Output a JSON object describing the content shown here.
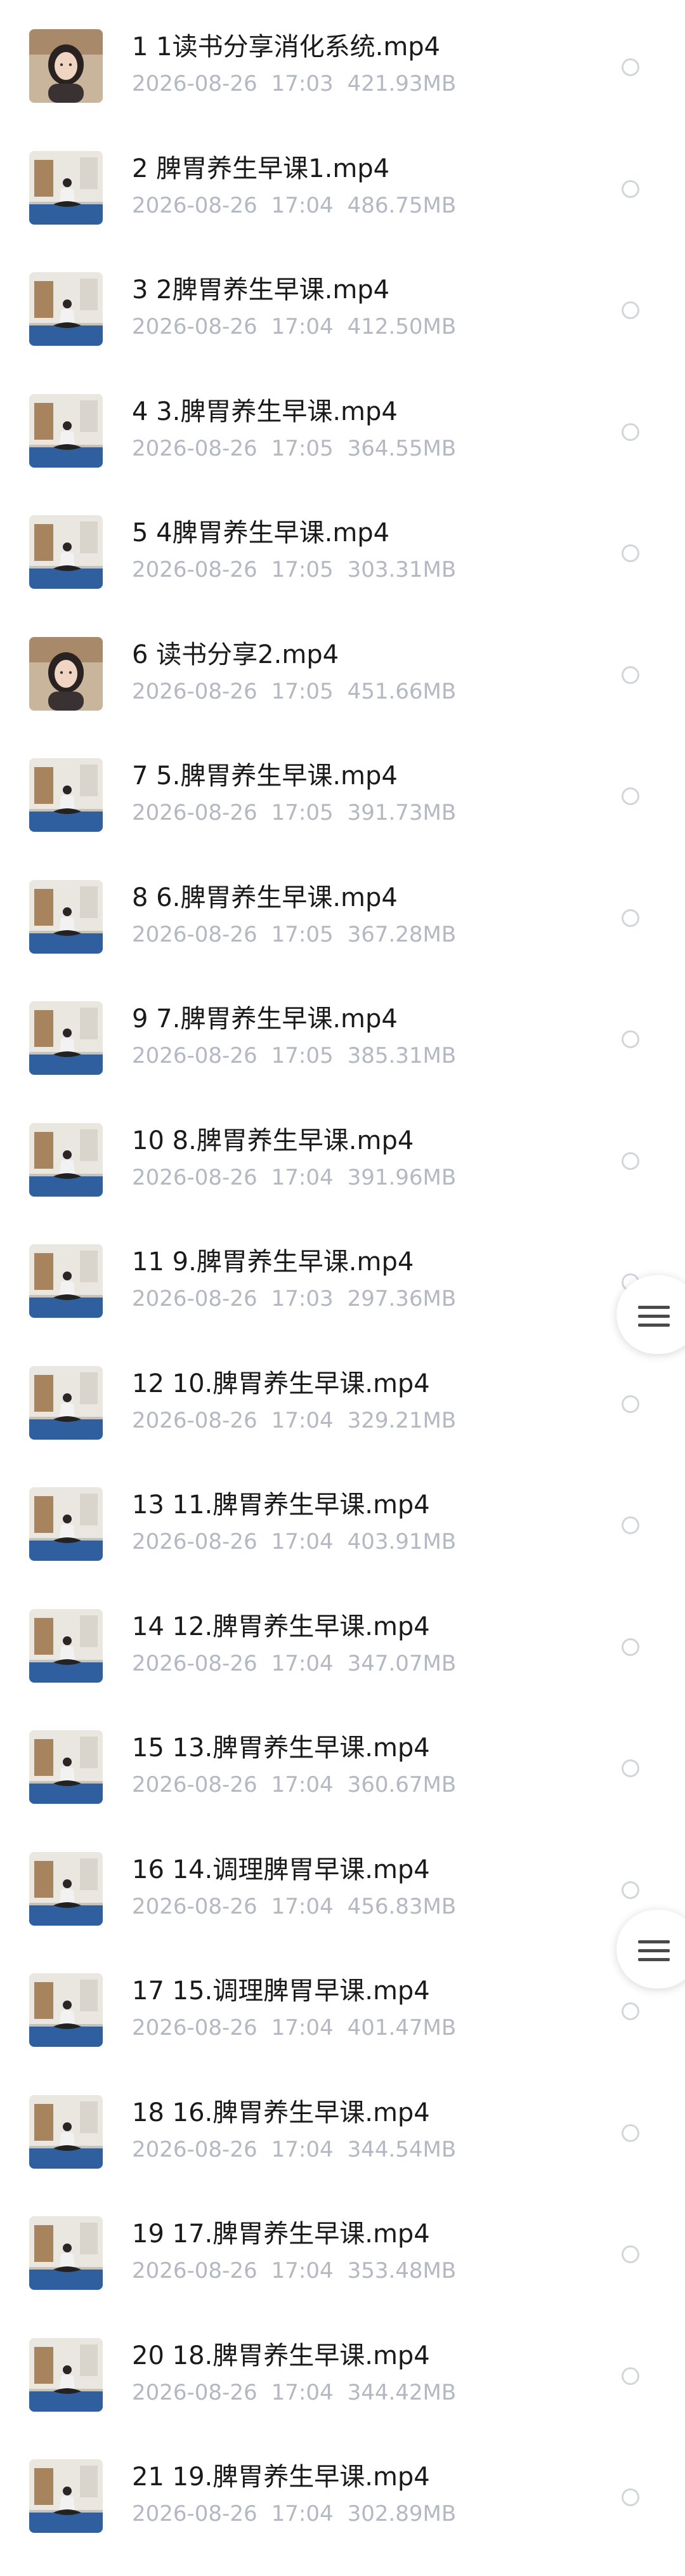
{
  "files": [
    {
      "name": "1 1读书分享消化系统.mp4",
      "date": "2026-08-26",
      "time": "17:03",
      "size": "421.93MB",
      "thumb": "portrait"
    },
    {
      "name": "2 脾胃养生早课1.mp4",
      "date": "2026-08-26",
      "time": "17:04",
      "size": "486.75MB",
      "thumb": "yoga"
    },
    {
      "name": "3 2脾胃养生早课.mp4",
      "date": "2026-08-26",
      "time": "17:04",
      "size": "412.50MB",
      "thumb": "yoga"
    },
    {
      "name": "4 3.脾胃养生早课.mp4",
      "date": "2026-08-26",
      "time": "17:05",
      "size": "364.55MB",
      "thumb": "yoga"
    },
    {
      "name": "5 4脾胃养生早课.mp4",
      "date": "2026-08-26",
      "time": "17:05",
      "size": "303.31MB",
      "thumb": "yoga"
    },
    {
      "name": "6 读书分享2.mp4",
      "date": "2026-08-26",
      "time": "17:05",
      "size": "451.66MB",
      "thumb": "portrait"
    },
    {
      "name": "7 5.脾胃养生早课.mp4",
      "date": "2026-08-26",
      "time": "17:05",
      "size": "391.73MB",
      "thumb": "yoga"
    },
    {
      "name": "8 6.脾胃养生早课.mp4",
      "date": "2026-08-26",
      "time": "17:05",
      "size": "367.28MB",
      "thumb": "yoga"
    },
    {
      "name": "9 7.脾胃养生早课.mp4",
      "date": "2026-08-26",
      "time": "17:05",
      "size": "385.31MB",
      "thumb": "yoga"
    },
    {
      "name": "10 8.脾胃养生早课.mp4",
      "date": "2026-08-26",
      "time": "17:04",
      "size": "391.96MB",
      "thumb": "yoga"
    },
    {
      "name": "11 9.脾胃养生早课.mp4",
      "date": "2026-08-26",
      "time": "17:03",
      "size": "297.36MB",
      "thumb": "yoga"
    },
    {
      "name": "12 10.脾胃养生早课.mp4",
      "date": "2026-08-26",
      "time": "17:04",
      "size": "329.21MB",
      "thumb": "yoga"
    },
    {
      "name": "13 11.脾胃养生早课.mp4",
      "date": "2026-08-26",
      "time": "17:04",
      "size": "403.91MB",
      "thumb": "yoga"
    },
    {
      "name": "14 12.脾胃养生早课.mp4",
      "date": "2026-08-26",
      "time": "17:04",
      "size": "347.07MB",
      "thumb": "yoga"
    },
    {
      "name": "15 13.脾胃养生早课.mp4",
      "date": "2026-08-26",
      "time": "17:04",
      "size": "360.67MB",
      "thumb": "yoga"
    },
    {
      "name": "16 14.调理脾胃早课.mp4",
      "date": "2026-08-26",
      "time": "17:04",
      "size": "456.83MB",
      "thumb": "yoga"
    },
    {
      "name": "17 15.调理脾胃早课.mp4",
      "date": "2026-08-26",
      "time": "17:04",
      "size": "401.47MB",
      "thumb": "yoga"
    },
    {
      "name": "18 16.脾胃养生早课.mp4",
      "date": "2026-08-26",
      "time": "17:04",
      "size": "344.54MB",
      "thumb": "yoga"
    },
    {
      "name": "19 17.脾胃养生早课.mp4",
      "date": "2026-08-26",
      "time": "17:04",
      "size": "353.48MB",
      "thumb": "yoga"
    },
    {
      "name": "20 18.脾胃养生早课.mp4",
      "date": "2026-08-26",
      "time": "17:04",
      "size": "344.42MB",
      "thumb": "yoga"
    },
    {
      "name": "21 19.脾胃养生早课.mp4",
      "date": "2026-08-26",
      "time": "17:04",
      "size": "302.89MB",
      "thumb": "yoga"
    }
  ],
  "floating_buttons": [
    {
      "icon": "menu-icon"
    },
    {
      "icon": "menu-icon"
    }
  ],
  "colors": {
    "title": "#1a1a1a",
    "meta": "#b3b8c2",
    "radio_border": "#d2d5da",
    "mat_blue": "#2f5f9e"
  }
}
